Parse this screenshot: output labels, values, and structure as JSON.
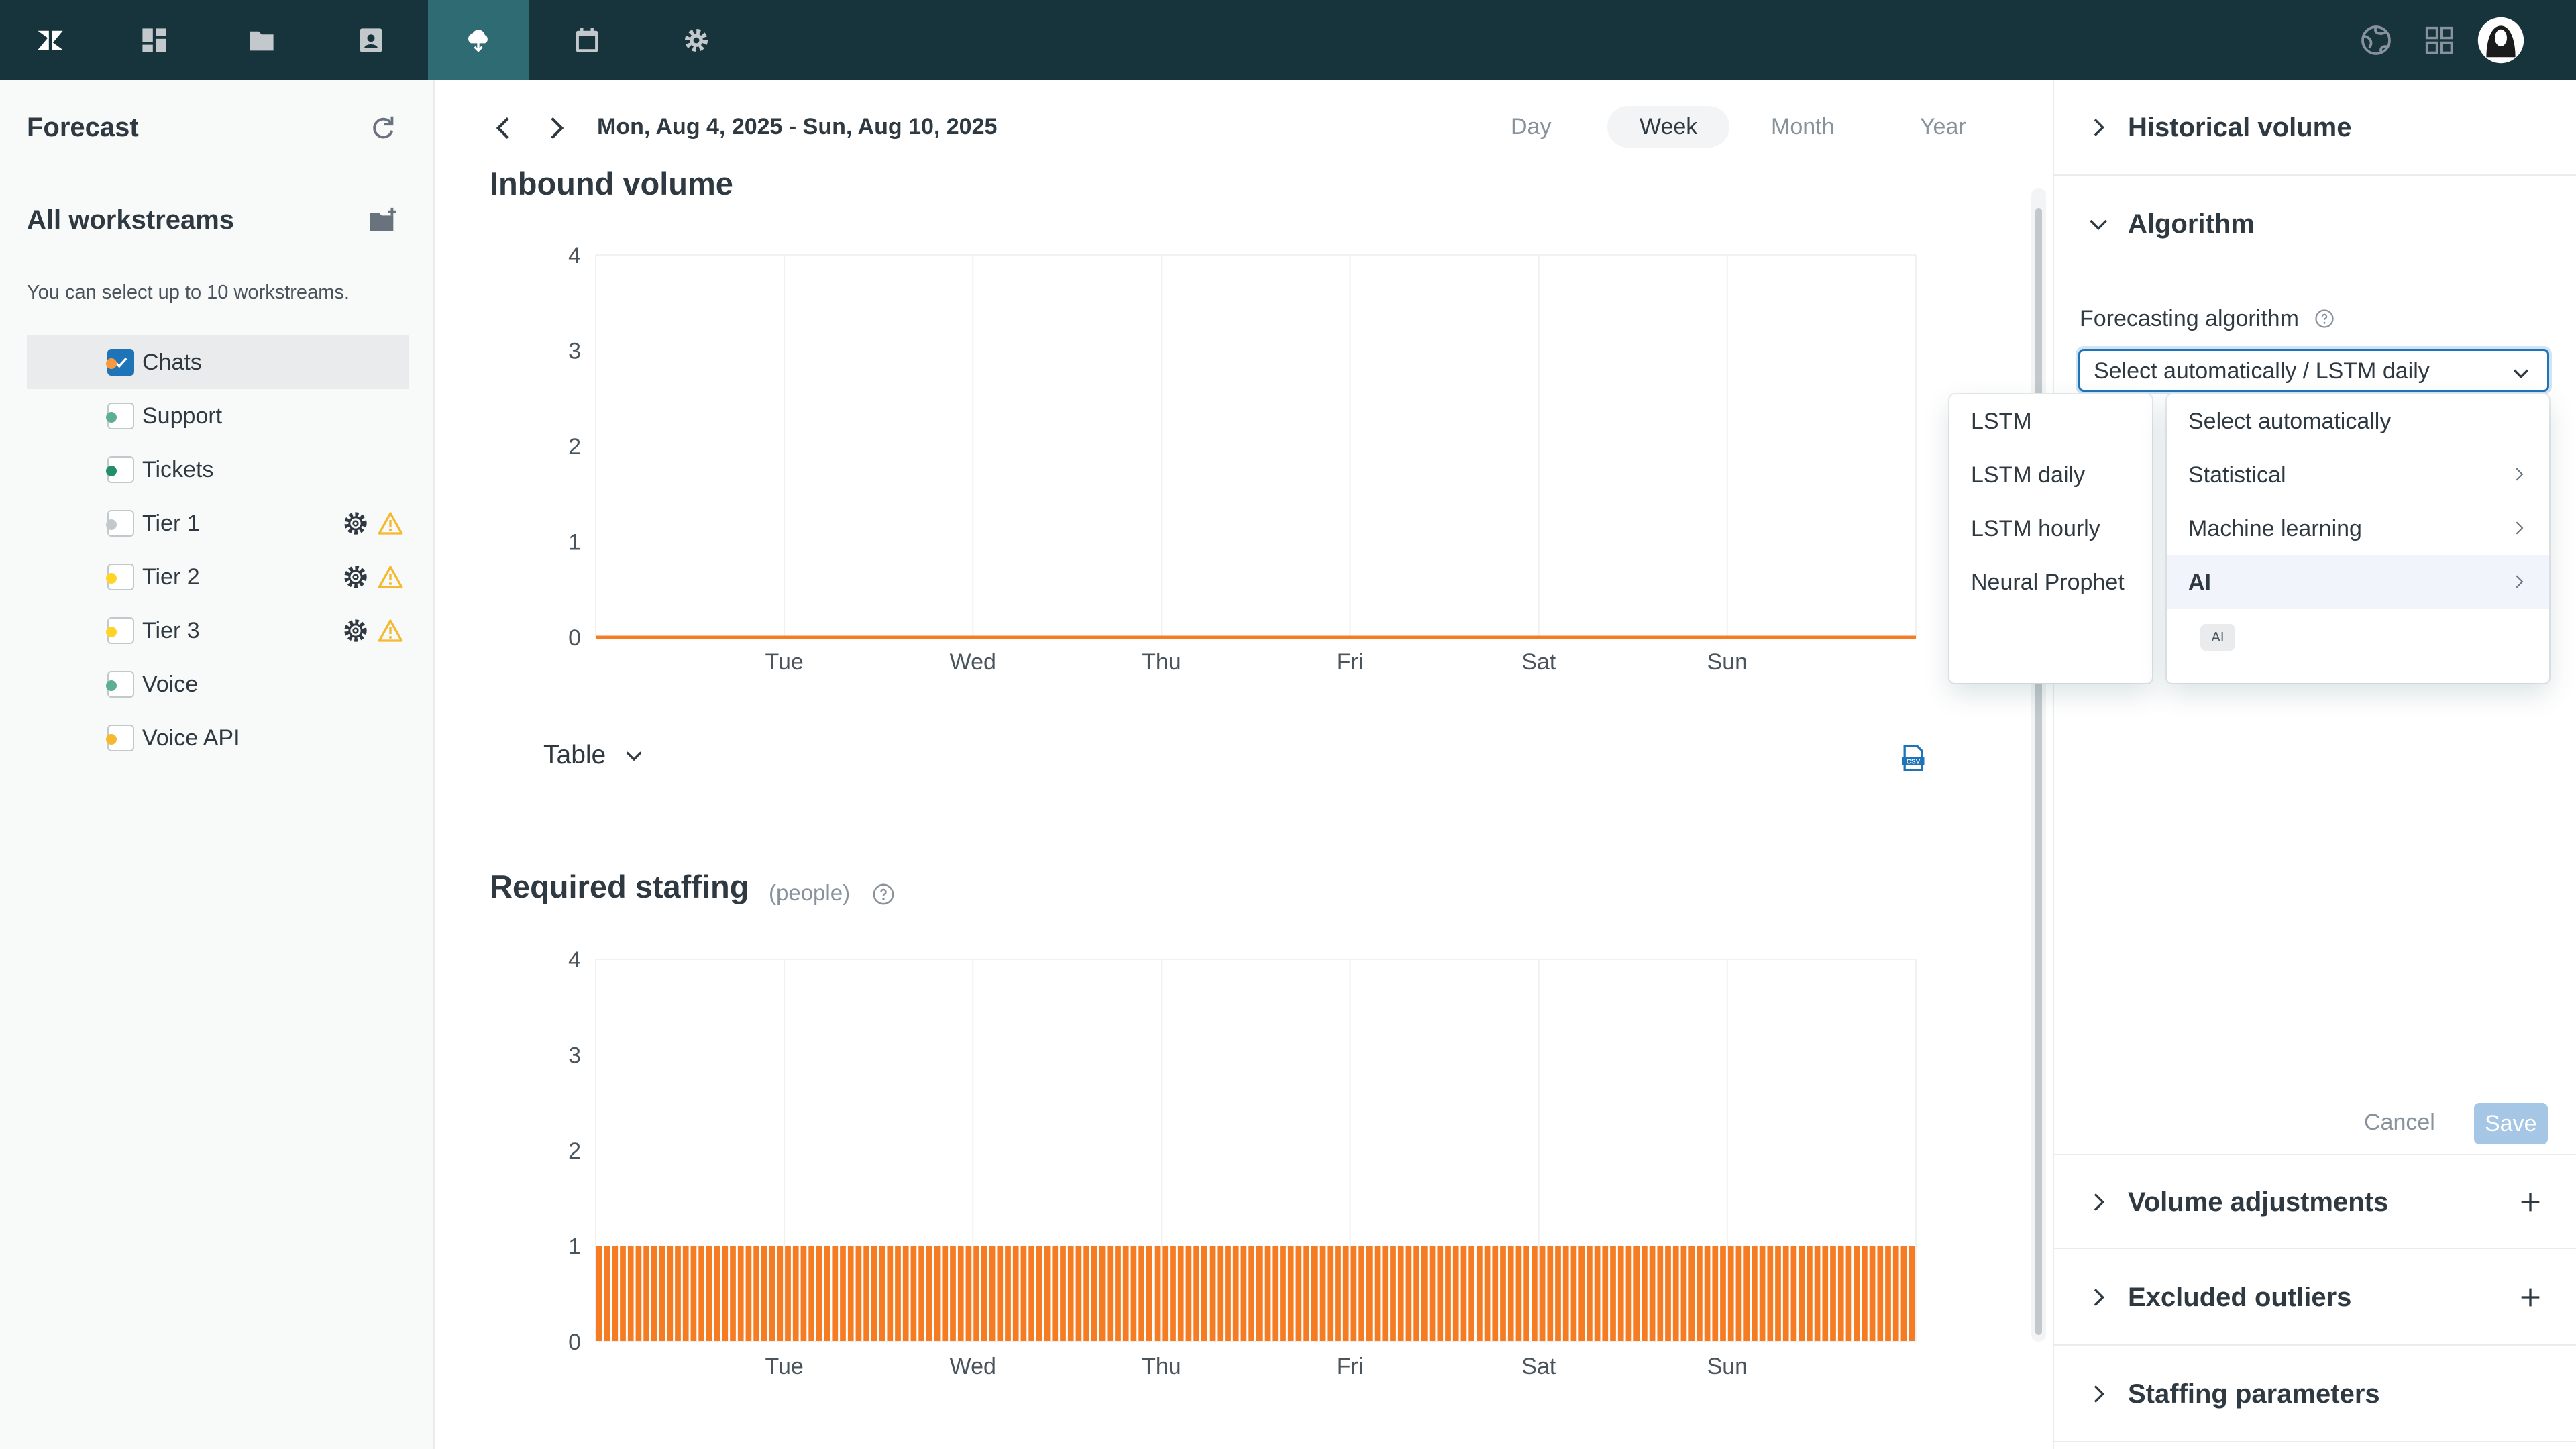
{
  "topbar": {
    "nav_icons": [
      "zendesk-logo",
      "dashboard-icon",
      "folder-icon",
      "contacts-icon",
      "forecast-icon",
      "calendar-icon",
      "gear-icon"
    ],
    "active_index": 4,
    "right_icons": [
      "globe-icon",
      "apps-grid-icon",
      "user-avatar"
    ],
    "bg_color": "#17343d",
    "active_color": "#2f6b73"
  },
  "sidebar": {
    "title": "Forecast",
    "section_title": "All workstreams",
    "hint": "You can select up to 10 workstreams.",
    "workstreams": [
      {
        "label": "Chats",
        "color": "#f79a3e",
        "checked": true,
        "warnings": false
      },
      {
        "label": "Support",
        "color": "#5eae91",
        "checked": false,
        "warnings": false
      },
      {
        "label": "Tickets",
        "color": "#228f67",
        "checked": false,
        "warnings": false
      },
      {
        "label": "Tier 1",
        "color": "#c2c8cc",
        "checked": false,
        "warnings": true
      },
      {
        "label": "Tier 2",
        "color": "#ffd424",
        "checked": false,
        "warnings": true
      },
      {
        "label": "Tier 3",
        "color": "#ffd424",
        "checked": false,
        "warnings": true
      },
      {
        "label": "Voice",
        "color": "#5eae91",
        "checked": false,
        "warnings": false
      },
      {
        "label": "Voice API",
        "color": "#f5b82e",
        "checked": false,
        "warnings": false
      }
    ]
  },
  "header": {
    "date_range": "Mon, Aug 4, 2025 - Sun, Aug 10, 2025",
    "periods": [
      "Day",
      "Week",
      "Month",
      "Year"
    ],
    "active_period": "Week"
  },
  "inbound": {
    "title": "Inbound volume"
  },
  "table_toggle": {
    "label": "Table"
  },
  "staffing": {
    "title": "Required staffing",
    "subtitle": "(people)"
  },
  "chart_data": [
    {
      "type": "line",
      "title": "Inbound volume",
      "categories": [
        "Tue",
        "Wed",
        "Thu",
        "Fri",
        "Sat",
        "Sun"
      ],
      "yticks": [
        0,
        1,
        2,
        3,
        4
      ],
      "ylim": [
        0,
        4
      ],
      "series": [
        {
          "values": [
            0,
            0,
            0,
            0,
            0,
            0,
            0
          ]
        }
      ],
      "color": "#f57c22",
      "grid": true
    },
    {
      "type": "bar",
      "title": "Required staffing",
      "categories": [
        "Tue",
        "Wed",
        "Thu",
        "Fri",
        "Sat",
        "Sun"
      ],
      "yticks": [
        0,
        1,
        2,
        3,
        4
      ],
      "ylim": [
        0,
        4
      ],
      "bar_value": 1,
      "bar_count": 168,
      "color": "#f57c22",
      "grid": true
    }
  ],
  "right_panel": {
    "accordions": [
      {
        "title": "Historical volume",
        "expanded": false,
        "plus": false
      },
      {
        "title": "Algorithm",
        "expanded": true,
        "plus": false
      },
      {
        "title": "Volume adjustments",
        "expanded": false,
        "plus": true
      },
      {
        "title": "Excluded outliers",
        "expanded": false,
        "plus": true
      },
      {
        "title": "Staffing parameters",
        "expanded": false,
        "plus": false
      }
    ],
    "field_label": "Forecasting algorithm",
    "select_value": "Select automatically / LSTM daily",
    "cancel_label": "Cancel",
    "save_label": "Save"
  },
  "menu_primary": {
    "items": [
      {
        "label": "Select automatically",
        "submenu": false
      },
      {
        "label": "Statistical",
        "submenu": true
      },
      {
        "label": "Machine learning",
        "submenu": true
      },
      {
        "label": "AI",
        "submenu": true,
        "hover": true
      }
    ],
    "badge": "AI"
  },
  "menu_secondary": {
    "items": [
      "LSTM",
      "LSTM daily",
      "LSTM hourly",
      "Neural Prophet"
    ]
  }
}
